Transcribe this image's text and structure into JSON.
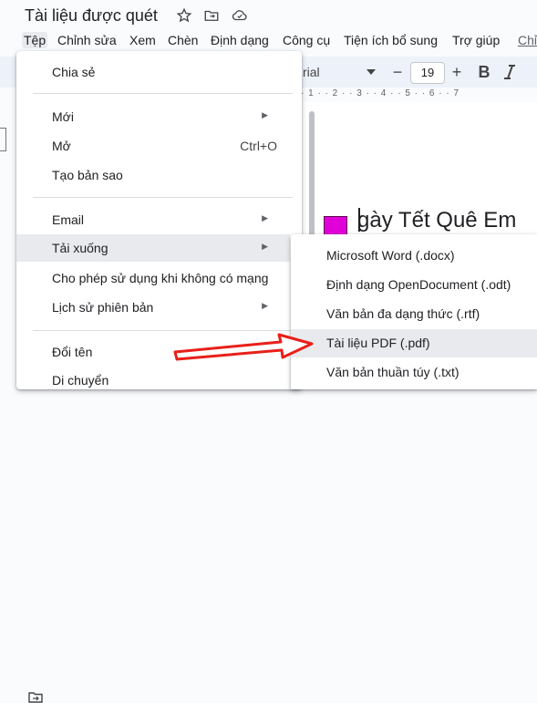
{
  "document": {
    "title": "Tài liệu được quét"
  },
  "menubar": {
    "items": [
      "Tệp",
      "Chỉnh sửa",
      "Xem",
      "Chèn",
      "Định dạng",
      "Công cụ",
      "Tiện ích bổ sung",
      "Trợ giúp",
      "Chỉ"
    ]
  },
  "toolbar": {
    "font": "rial",
    "font_size": "19",
    "minus": "−",
    "plus": "+",
    "bold": "B"
  },
  "ruler": {
    "text": "· 1 · · 2 · · 3 · · 4 · · 5 · · 6 · · 7"
  },
  "document_body": {
    "heading": "gày Tết Quê Em"
  },
  "file_menu": {
    "items": [
      {
        "label": "Chia sẻ"
      },
      {
        "label": "Mới",
        "submenu": "▶"
      },
      {
        "label": "Mở",
        "shortcut": "Ctrl+O"
      },
      {
        "label": "Tạo bản sao"
      },
      {
        "label": "Email",
        "submenu": "▶"
      },
      {
        "label": "Tải xuống",
        "submenu": "▶"
      },
      {
        "label": "Cho phép sử dụng khi không có mạng"
      },
      {
        "label": "Lịch sử phiên bản",
        "submenu": "▶"
      },
      {
        "label": "Đổi tên"
      },
      {
        "label": "Di chuyển"
      }
    ]
  },
  "download_submenu": {
    "items": [
      {
        "label": "Microsoft Word (.docx)"
      },
      {
        "label": "Định dạng OpenDocument (.odt)"
      },
      {
        "label": "Văn bản đa dạng thức (.rtf)"
      },
      {
        "label": "Tài liệu PDF (.pdf)"
      },
      {
        "label": "Văn bản thuần túy (.txt)"
      }
    ]
  },
  "watermark_glyph": "▶",
  "colors": {
    "highlight": "#e8eaed",
    "annotation_arrow": "#e8201a",
    "heading_marker": "#e000d8"
  }
}
